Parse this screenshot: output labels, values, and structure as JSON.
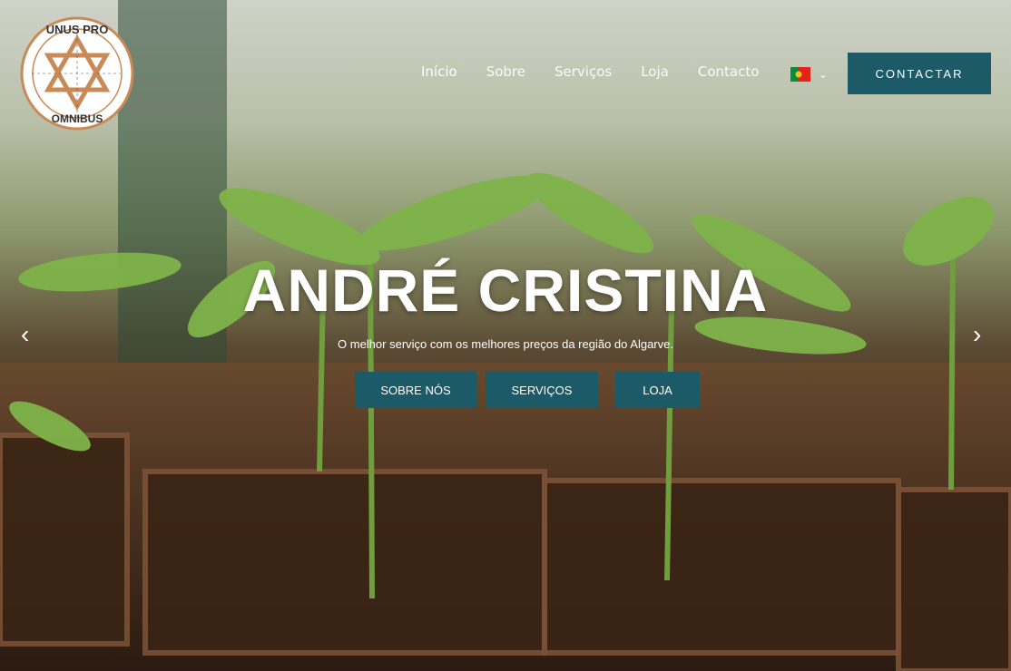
{
  "logo": {
    "top_text": "UNUS PRO",
    "bottom_text": "OMNIBUS"
  },
  "nav": [
    {
      "label": "Início"
    },
    {
      "label": "Sobre"
    },
    {
      "label": "Serviços"
    },
    {
      "label": "Loja"
    },
    {
      "label": "Contacto"
    }
  ],
  "cta_label": "CONTACTAR",
  "hero": {
    "title": "ANDRÉ CRISTINA",
    "subtitle": "O melhor serviço com os melhores preços da região do Algarve.",
    "buttons": [
      "SOBRE NÓS",
      "SERVIÇOS",
      "LOJA"
    ]
  },
  "colors": {
    "accent": "#1d5a67",
    "logo_ring": "#c98a57"
  },
  "icons": {
    "prev": "chevron-left-icon",
    "next": "chevron-right-icon",
    "language": "flag-portugal-icon"
  }
}
